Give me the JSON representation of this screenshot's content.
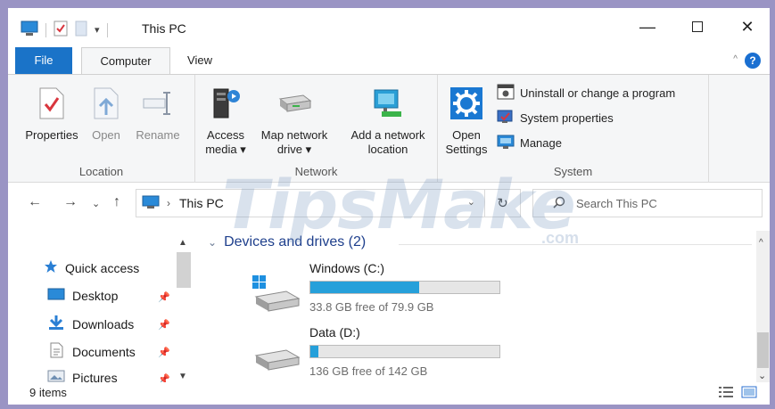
{
  "window": {
    "title": "This PC"
  },
  "tabs": [
    {
      "label": "File"
    },
    {
      "label": "Computer"
    },
    {
      "label": "View"
    }
  ],
  "ribbon": {
    "location": {
      "label": "Location",
      "buttons": [
        {
          "label": "Properties"
        },
        {
          "label": "Open"
        },
        {
          "label": "Rename"
        }
      ]
    },
    "network": {
      "label": "Network",
      "buttons": [
        {
          "line1": "Access",
          "line2": "media ▾"
        },
        {
          "line1": "Map network",
          "line2": "drive ▾"
        },
        {
          "line1": "Add a network",
          "line2": "location"
        }
      ]
    },
    "system": {
      "label": "System",
      "open_settings_line1": "Open",
      "open_settings_line2": "Settings",
      "items": [
        {
          "label": "Uninstall or change a program"
        },
        {
          "label": "System properties"
        },
        {
          "label": "Manage"
        }
      ]
    }
  },
  "address": {
    "path": "This PC",
    "search_placeholder": "Search This PC"
  },
  "nav": {
    "items": [
      {
        "label": "Quick access"
      },
      {
        "label": "Desktop"
      },
      {
        "label": "Downloads"
      },
      {
        "label": "Documents"
      },
      {
        "label": "Pictures"
      }
    ]
  },
  "content": {
    "section_title": "Devices and drives (2)",
    "drives": [
      {
        "name": "Windows (C:)",
        "free": "33.8 GB free of 79.9 GB",
        "used_fraction": 0.577
      },
      {
        "name": "Data (D:)",
        "free": "136 GB free of 142 GB",
        "used_fraction": 0.042
      }
    ]
  },
  "status": {
    "items_count": "9 items"
  },
  "watermark": {
    "text": "TipsMake",
    "suffix": ".com"
  },
  "colors": {
    "accent": "#1a73c8",
    "drive_bar": "#26a0da",
    "section_title": "#1e3f8c"
  }
}
